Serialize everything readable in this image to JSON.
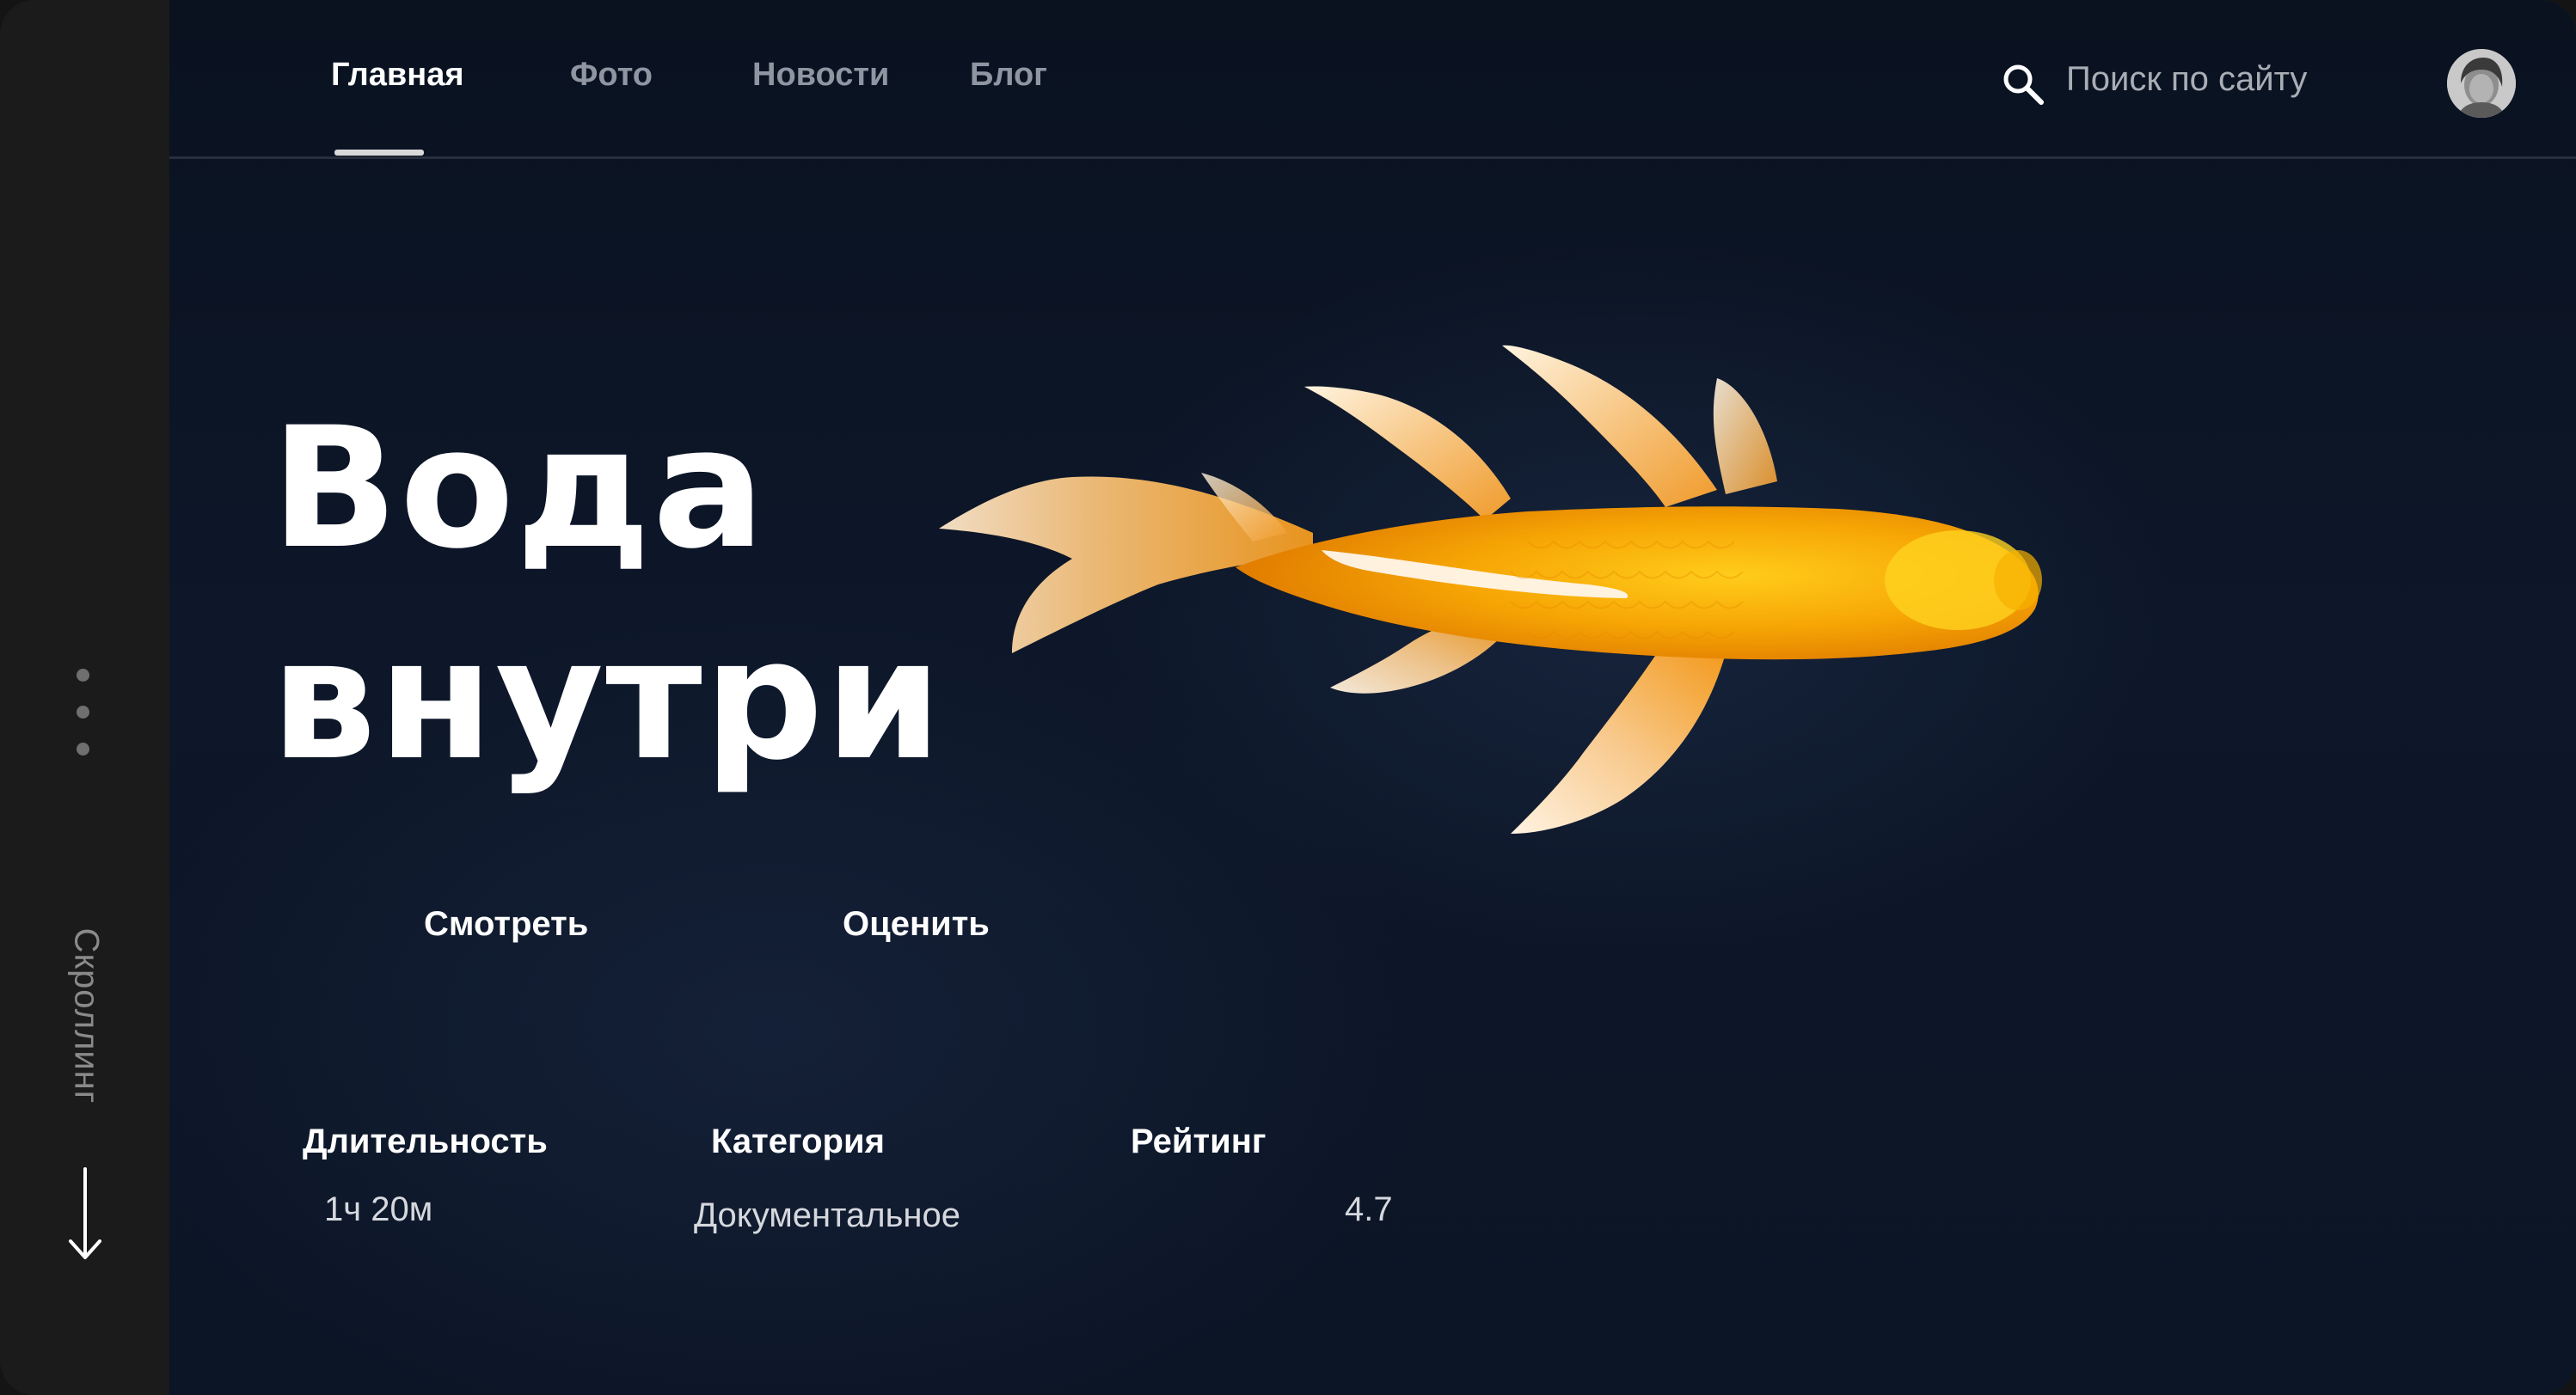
{
  "sidebar": {
    "scroll_label": "Скроллинг",
    "icons": [
      "more-dots-icon",
      "arrow-down-icon"
    ]
  },
  "nav": {
    "items": [
      {
        "label": "Главная",
        "active": true
      },
      {
        "label": "Фото",
        "active": false
      },
      {
        "label": "Новости",
        "active": false
      },
      {
        "label": "Блог",
        "active": false
      }
    ]
  },
  "search": {
    "placeholder": "Поиск по сайту",
    "icon": "search-icon"
  },
  "hero": {
    "title_line1": "Вода",
    "title_line2": "внутри",
    "actions": {
      "watch_label": "Смотреть",
      "rate_label": "Оценить"
    },
    "meta": {
      "duration_label": "Длительность",
      "duration_value": "1ч 20м",
      "category_label": "Категория",
      "category_value": "Документальное",
      "rating_label": "Рейтинг",
      "rating_value": "4.7"
    }
  },
  "colors": {
    "background": "#0c1526",
    "sidebar": "#1b1b1b",
    "accent_fish": "#f5a100",
    "text_primary": "#ffffff",
    "text_muted": "#8f96a2"
  }
}
